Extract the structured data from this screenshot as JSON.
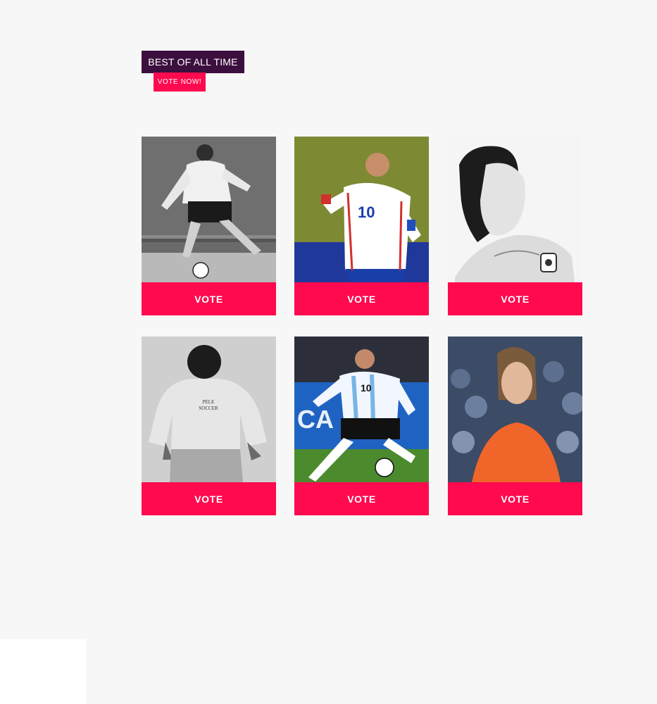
{
  "header": {
    "title": "BEST OF ALL TIME",
    "cta_label": "VOTE NOW!"
  },
  "colors": {
    "accent": "#ff0a4f",
    "title_bg": "#3b0f3e",
    "page_bg": "#f7f7f7"
  },
  "cards": [
    {
      "vote_label": "VOTE",
      "photo": "player-photo-bw-white-kit"
    },
    {
      "vote_label": "VOTE",
      "photo": "player-photo-france-10"
    },
    {
      "vote_label": "VOTE",
      "photo": "player-sketch-argentina"
    },
    {
      "vote_label": "VOTE",
      "photo": "player-photo-bw-smiling"
    },
    {
      "vote_label": "VOTE",
      "photo": "player-photo-argentina-10"
    },
    {
      "vote_label": "VOTE",
      "photo": "player-photo-orange-kit"
    }
  ]
}
